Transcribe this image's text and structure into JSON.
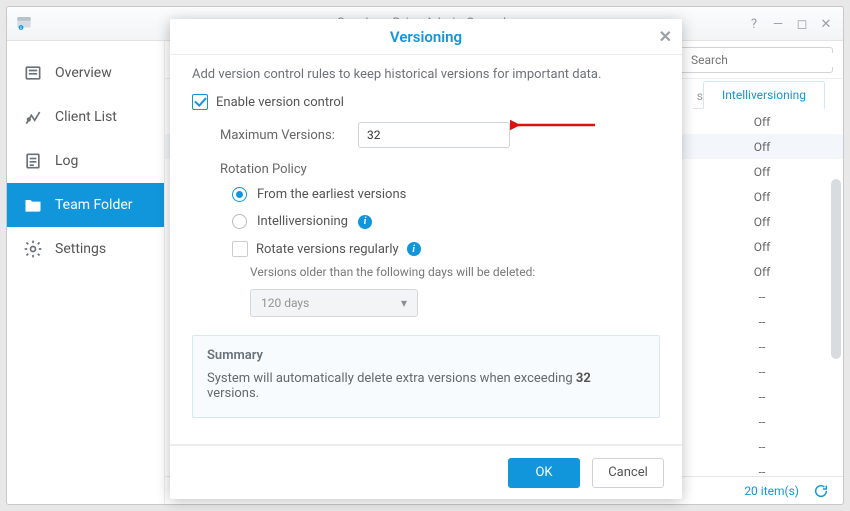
{
  "window": {
    "title": "Synology Drive Admin Console",
    "search_placeholder": "Search"
  },
  "sidebar": {
    "items": [
      {
        "label": "Overview"
      },
      {
        "label": "Client List"
      },
      {
        "label": "Log"
      },
      {
        "label": "Team Folder"
      },
      {
        "label": "Settings"
      }
    ]
  },
  "columns": {
    "stub_letter": "s",
    "intelliversioning": "Intelliversioning"
  },
  "rows": [
    {
      "val": "Off"
    },
    {
      "val": "Off"
    },
    {
      "val": "Off"
    },
    {
      "val": "Off"
    },
    {
      "val": "Off"
    },
    {
      "val": "Off"
    },
    {
      "val": "Off"
    },
    {
      "val": "--"
    },
    {
      "val": "--"
    },
    {
      "val": "--"
    },
    {
      "val": "--"
    },
    {
      "val": "--"
    },
    {
      "val": "--"
    },
    {
      "val": "--"
    },
    {
      "val": "--"
    }
  ],
  "status": {
    "count_text": "20 item(s)"
  },
  "modal": {
    "title": "Versioning",
    "intro": "Add version control rules to keep historical versions for important data.",
    "enable_label": "Enable version control",
    "max_versions_label": "Maximum Versions:",
    "max_versions_value": "32",
    "rotation_label": "Rotation Policy",
    "opt_earliest": "From the earliest versions",
    "opt_intelli": "Intelliversioning",
    "rotate_reg": "Rotate versions regularly",
    "older_than": "Versions older than the following days will be deleted:",
    "days_select": "120 days",
    "summary_title": "Summary",
    "summary_text_a": "System will automatically delete extra versions when exceeding ",
    "summary_text_b": " versions.",
    "summary_bold": "32",
    "ok": "OK",
    "cancel": "Cancel"
  }
}
